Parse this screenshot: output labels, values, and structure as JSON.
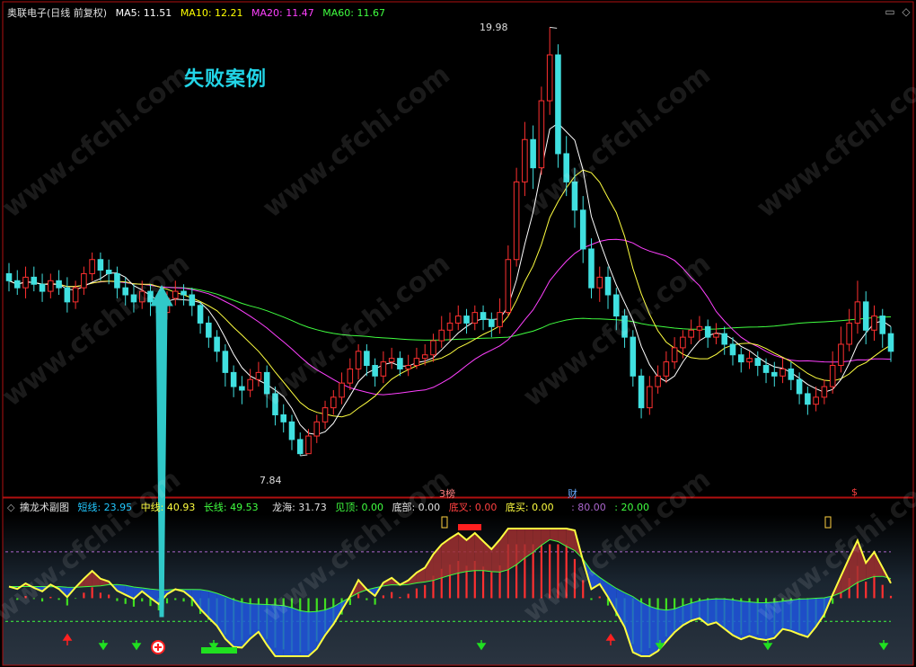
{
  "header": {
    "stock": "奥联电子",
    "period": "(日线 前复权)",
    "ma": [
      {
        "label": "MA5: 11.51",
        "color": "#ffffff"
      },
      {
        "label": "MA10: 12.21",
        "color": "#ffff00"
      },
      {
        "label": "MA20: 11.47",
        "color": "#ff40ff"
      },
      {
        "label": "MA60: 11.67",
        "color": "#40ff40"
      }
    ]
  },
  "title": "失败案例",
  "watermark": "www.cfchi.com",
  "annotations": {
    "high_label": "19.98",
    "low_label": "7.84",
    "event_bang": "榜",
    "event_bang_num": "3",
    "event_cai": "财",
    "event_s": "$"
  },
  "indicator": {
    "name": "擒龙术副图",
    "items": [
      {
        "label": "短线: 23.95",
        "color": "#22c8ff"
      },
      {
        "label": "中线: 40.93",
        "color": "#ffff40"
      },
      {
        "label": "长线: 49.53",
        "color": "#40ff40"
      },
      {
        "label": "龙海: 31.73",
        "color": "#e0e0e0"
      },
      {
        "label": "见顶: 0.00",
        "color": "#40ff40"
      },
      {
        "label": "底部: 0.00",
        "color": "#e0e0e0"
      },
      {
        "label": "底叉: 0.00",
        "color": "#ff4040"
      },
      {
        "label": "底买: 0.00",
        "color": "#ffff40"
      },
      {
        "label": ": 80.00",
        "color": "#aa66cc"
      },
      {
        "label": ": 20.00",
        "color": "#40ff40"
      }
    ]
  },
  "colors": {
    "up": "#ff3030",
    "down": "#40e0e0",
    "ma5": "#ffffff",
    "ma10": "#ffff40",
    "ma20": "#ff40ff",
    "ma60": "#40ff40",
    "frame": "#b01010"
  },
  "chart_data": [
    {
      "type": "candlestick",
      "title": "奥联电子 (日线 前复权)",
      "ylim": [
        7.0,
        20.5
      ],
      "candles": [
        [
          13.0,
          12.8,
          13.3,
          12.5
        ],
        [
          12.8,
          12.6,
          13.1,
          12.4
        ],
        [
          12.6,
          12.9,
          13.2,
          12.3
        ],
        [
          12.9,
          12.7,
          13.2,
          12.5
        ],
        [
          12.7,
          12.5,
          13.0,
          12.2
        ],
        [
          12.5,
          12.8,
          13.0,
          12.3
        ],
        [
          12.8,
          12.6,
          13.1,
          12.4
        ],
        [
          12.6,
          12.2,
          12.9,
          11.9
        ],
        [
          12.2,
          12.6,
          12.8,
          12.0
        ],
        [
          12.6,
          13.0,
          13.2,
          12.4
        ],
        [
          13.0,
          13.4,
          13.6,
          12.8
        ],
        [
          13.4,
          13.1,
          13.6,
          12.8
        ],
        [
          13.1,
          13.0,
          13.4,
          12.7
        ],
        [
          13.0,
          12.6,
          13.2,
          12.3
        ],
        [
          12.6,
          12.4,
          12.9,
          12.1
        ],
        [
          12.4,
          12.2,
          12.7,
          11.9
        ],
        [
          12.2,
          12.5,
          12.8,
          12.0
        ],
        [
          12.5,
          12.2,
          12.7,
          11.8
        ],
        [
          12.2,
          11.9,
          12.4,
          11.6
        ],
        [
          11.9,
          12.3,
          12.5,
          11.7
        ],
        [
          12.3,
          12.5,
          12.8,
          12.1
        ],
        [
          12.5,
          12.4,
          12.7,
          12.1
        ],
        [
          12.4,
          12.1,
          12.6,
          11.8
        ],
        [
          12.1,
          11.6,
          12.2,
          11.3
        ],
        [
          11.6,
          11.2,
          11.8,
          10.9
        ],
        [
          11.2,
          10.8,
          11.4,
          10.5
        ],
        [
          10.8,
          10.2,
          11.0,
          9.8
        ],
        [
          10.2,
          9.8,
          10.4,
          9.5
        ],
        [
          9.8,
          9.7,
          10.1,
          9.3
        ],
        [
          9.7,
          10.0,
          10.3,
          9.5
        ],
        [
          10.0,
          10.2,
          10.5,
          9.8
        ],
        [
          10.2,
          9.6,
          10.4,
          9.2
        ],
        [
          9.6,
          9.0,
          9.8,
          8.7
        ],
        [
          9.0,
          8.8,
          9.3,
          8.5
        ],
        [
          8.8,
          8.3,
          9.0,
          8.0
        ],
        [
          8.3,
          7.9,
          8.5,
          7.84
        ],
        [
          7.9,
          8.4,
          8.6,
          7.9
        ],
        [
          8.4,
          8.8,
          9.0,
          8.2
        ],
        [
          8.8,
          9.2,
          9.4,
          8.6
        ],
        [
          9.2,
          9.5,
          9.7,
          9.0
        ],
        [
          9.5,
          9.9,
          10.2,
          9.3
        ],
        [
          9.9,
          10.3,
          10.6,
          9.7
        ],
        [
          10.3,
          10.8,
          11.0,
          10.0
        ],
        [
          10.8,
          10.4,
          11.0,
          10.1
        ],
        [
          10.4,
          10.1,
          10.6,
          9.8
        ],
        [
          10.1,
          10.5,
          10.8,
          9.9
        ],
        [
          10.5,
          10.6,
          10.9,
          10.3
        ],
        [
          10.6,
          10.3,
          10.8,
          10.1
        ],
        [
          10.3,
          10.4,
          10.7,
          10.1
        ],
        [
          10.4,
          10.6,
          10.9,
          10.3
        ],
        [
          10.6,
          10.7,
          11.0,
          10.4
        ],
        [
          10.7,
          11.1,
          11.3,
          10.5
        ],
        [
          11.1,
          11.4,
          11.8,
          10.9
        ],
        [
          11.4,
          11.6,
          11.9,
          11.1
        ],
        [
          11.6,
          11.8,
          12.1,
          11.4
        ],
        [
          11.8,
          11.6,
          12.0,
          11.3
        ],
        [
          11.6,
          11.9,
          12.1,
          11.4
        ],
        [
          11.9,
          11.7,
          12.1,
          11.4
        ],
        [
          11.7,
          11.5,
          11.9,
          11.2
        ],
        [
          11.5,
          11.9,
          12.3,
          11.3
        ],
        [
          11.9,
          13.4,
          13.8,
          11.8
        ],
        [
          13.4,
          15.6,
          16.0,
          13.2
        ],
        [
          15.6,
          16.8,
          17.3,
          15.2
        ],
        [
          16.8,
          16.0,
          17.2,
          15.4
        ],
        [
          16.0,
          17.9,
          18.3,
          15.8
        ],
        [
          17.9,
          19.2,
          19.98,
          17.5
        ],
        [
          19.2,
          16.4,
          19.5,
          16.0
        ],
        [
          16.4,
          15.6,
          16.9,
          15.2
        ],
        [
          15.6,
          14.8,
          16.0,
          14.3
        ],
        [
          14.8,
          13.7,
          15.2,
          13.3
        ],
        [
          13.7,
          12.6,
          14.0,
          12.3
        ],
        [
          12.6,
          12.9,
          13.2,
          12.2
        ],
        [
          12.9,
          12.4,
          13.2,
          12.0
        ],
        [
          12.4,
          11.8,
          12.6,
          11.4
        ],
        [
          11.8,
          11.2,
          12.0,
          10.9
        ],
        [
          11.2,
          10.1,
          11.4,
          9.8
        ],
        [
          10.1,
          9.2,
          10.3,
          8.9
        ],
        [
          9.2,
          9.8,
          10.1,
          9.0
        ],
        [
          9.8,
          10.1,
          10.4,
          9.6
        ],
        [
          10.1,
          10.5,
          10.8,
          9.9
        ],
        [
          10.5,
          10.9,
          11.2,
          10.3
        ],
        [
          10.9,
          11.2,
          11.4,
          10.6
        ],
        [
          11.2,
          11.4,
          11.7,
          11.0
        ],
        [
          11.4,
          11.5,
          11.8,
          11.1
        ],
        [
          11.5,
          11.2,
          11.7,
          10.9
        ],
        [
          11.2,
          11.3,
          11.6,
          11.0
        ],
        [
          11.3,
          11.0,
          11.5,
          10.7
        ],
        [
          11.0,
          10.7,
          11.2,
          10.4
        ],
        [
          10.7,
          10.5,
          10.9,
          10.2
        ],
        [
          10.5,
          10.6,
          10.8,
          10.3
        ],
        [
          10.6,
          10.4,
          10.8,
          10.1
        ],
        [
          10.4,
          10.2,
          10.6,
          9.9
        ],
        [
          10.2,
          10.1,
          10.5,
          9.8
        ],
        [
          10.1,
          10.3,
          10.6,
          9.9
        ],
        [
          10.3,
          10.0,
          10.5,
          9.7
        ],
        [
          10.0,
          9.6,
          10.2,
          9.3
        ],
        [
          9.6,
          9.3,
          9.8,
          9.0
        ],
        [
          9.3,
          9.5,
          9.8,
          9.1
        ],
        [
          9.5,
          9.8,
          10.0,
          9.3
        ],
        [
          9.8,
          10.4,
          10.8,
          9.6
        ],
        [
          10.4,
          11.0,
          11.5,
          10.2
        ],
        [
          11.0,
          11.6,
          12.0,
          10.8
        ],
        [
          11.6,
          12.2,
          12.8,
          11.3
        ],
        [
          12.2,
          11.4,
          12.5,
          11.0
        ],
        [
          11.4,
          11.8,
          12.1,
          11.1
        ],
        [
          11.8,
          11.3,
          12.0,
          10.9
        ],
        [
          11.3,
          10.8,
          11.5,
          10.5
        ]
      ]
    },
    {
      "type": "line",
      "title": "擒龙术副图",
      "ylim": [
        -10,
        100
      ],
      "reference_lines": [
        80,
        20
      ]
    }
  ]
}
